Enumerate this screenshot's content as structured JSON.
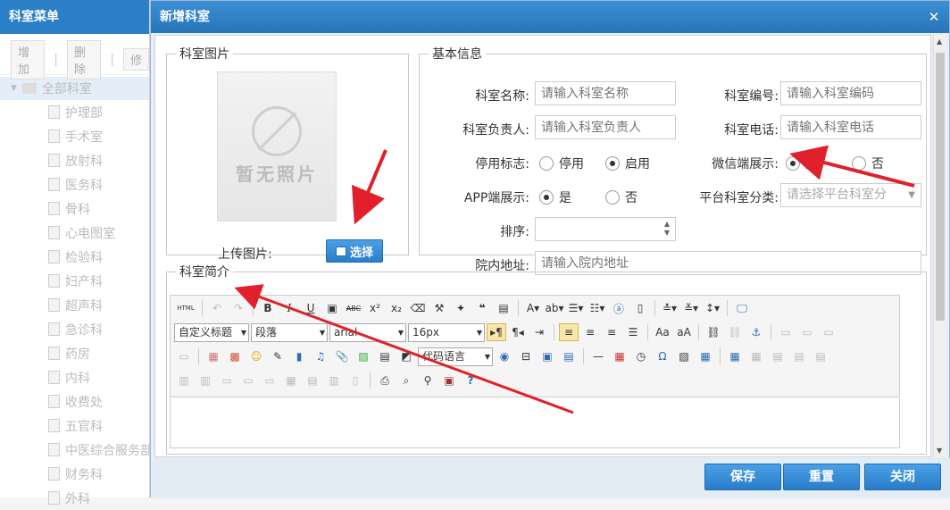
{
  "left_panel": {
    "title": "科室菜单",
    "toolbar": {
      "add": "增加",
      "delete": "删除",
      "edit": "修",
      "sep": "|"
    },
    "root": "全部科室",
    "items": [
      "护理部",
      "手术室",
      "放射科",
      "医务科",
      "骨科",
      "心电图室",
      "检验科",
      "妇产科",
      "超声科",
      "急诊科",
      "药房",
      "内科",
      "收费处",
      "五官科",
      "中医综合服务部",
      "财务科",
      "外科"
    ]
  },
  "dialog": {
    "title": "新增科室",
    "close": "✕",
    "image_section": {
      "legend": "科室图片",
      "no_photo": "暂无照片",
      "upload_label": "上传图片:",
      "select_button": "选择"
    },
    "info_section": {
      "legend": "基本信息",
      "name": {
        "label": "科室名称:",
        "placeholder": "请输入科室名称"
      },
      "code": {
        "label": "科室编号:",
        "placeholder": "请输入科室编码"
      },
      "head": {
        "label": "科室负责人:",
        "placeholder": "请输入科室负责人"
      },
      "phone": {
        "label": "科室电话:",
        "placeholder": "请输入科室电话"
      },
      "disable": {
        "label": "停用标志:",
        "opt_off": "停用",
        "opt_on": "启用"
      },
      "wechat": {
        "label": "微信端展示:",
        "yes": "是",
        "no": "否"
      },
      "app": {
        "label": "APP端展示:",
        "yes": "是",
        "no": "否"
      },
      "platform": {
        "label": "平台科室分类:",
        "placeholder": "请选择平台科室分"
      },
      "order": {
        "label": "排序:"
      },
      "address": {
        "label": "院内地址:",
        "placeholder": "请输入院内地址"
      }
    },
    "intro_section": {
      "legend": "科室简介",
      "toolbar": {
        "html": "HTML",
        "custom_title": "自定义标题",
        "paragraph": "段落",
        "font": "arial",
        "size": "16px",
        "code_lang": "代码语言"
      }
    },
    "footer": {
      "save": "保存",
      "reset": "重置",
      "close": "关闭"
    }
  },
  "colors": {
    "accent": "#2a7cc8",
    "arrow": "#e0202a"
  }
}
